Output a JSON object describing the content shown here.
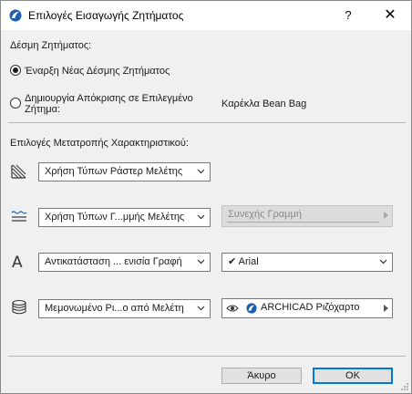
{
  "window": {
    "title": "Επιλογές Εισαγωγής Ζητήματος",
    "help_label": "?",
    "close_label": "✕"
  },
  "bundle": {
    "heading": "Δέσμη Ζητήματος:",
    "option_new": "Έναρξη Νέας Δέσμης Ζητήματος",
    "option_reply_line1": "Δημιουργία Απόκρισης σε Επιλεγμένο",
    "option_reply_line2": "Ζήτημα:",
    "selected_issue": "Καρέκλα Bean Bag",
    "selected_option": "new"
  },
  "conversion": {
    "heading": "Επιλογές Μετατροπής Χαρακτηριστικού:",
    "rows": [
      {
        "icon": "fill-pattern-icon",
        "select_value": "Χρήση Τύπων Ράστερ Μελέτης"
      },
      {
        "icon": "line-type-icon",
        "select_value": "Χρήση Τύπων Γ...μμής Μελέτης",
        "secondary_value": "Συνεχής Γραμμή",
        "secondary_enabled": false
      },
      {
        "icon": "font-icon",
        "icon_glyph": "A",
        "select_value": "Αντικατάσταση ... ενισία Γραφή",
        "secondary_check": "✔",
        "secondary_value": "Arial"
      },
      {
        "icon": "layers-icon",
        "select_value": "Μεμονωμένο Ρι...ο από Μελέτη",
        "secondary_value": "ARCHICAD Ριζόχαρτο"
      }
    ]
  },
  "buttons": {
    "cancel": "Άκυρο",
    "ok": "OK"
  },
  "colors": {
    "accent": "#0078d7",
    "dialog_bg": "#f0f0f0",
    "titlebar_bg": "#ffffff"
  }
}
